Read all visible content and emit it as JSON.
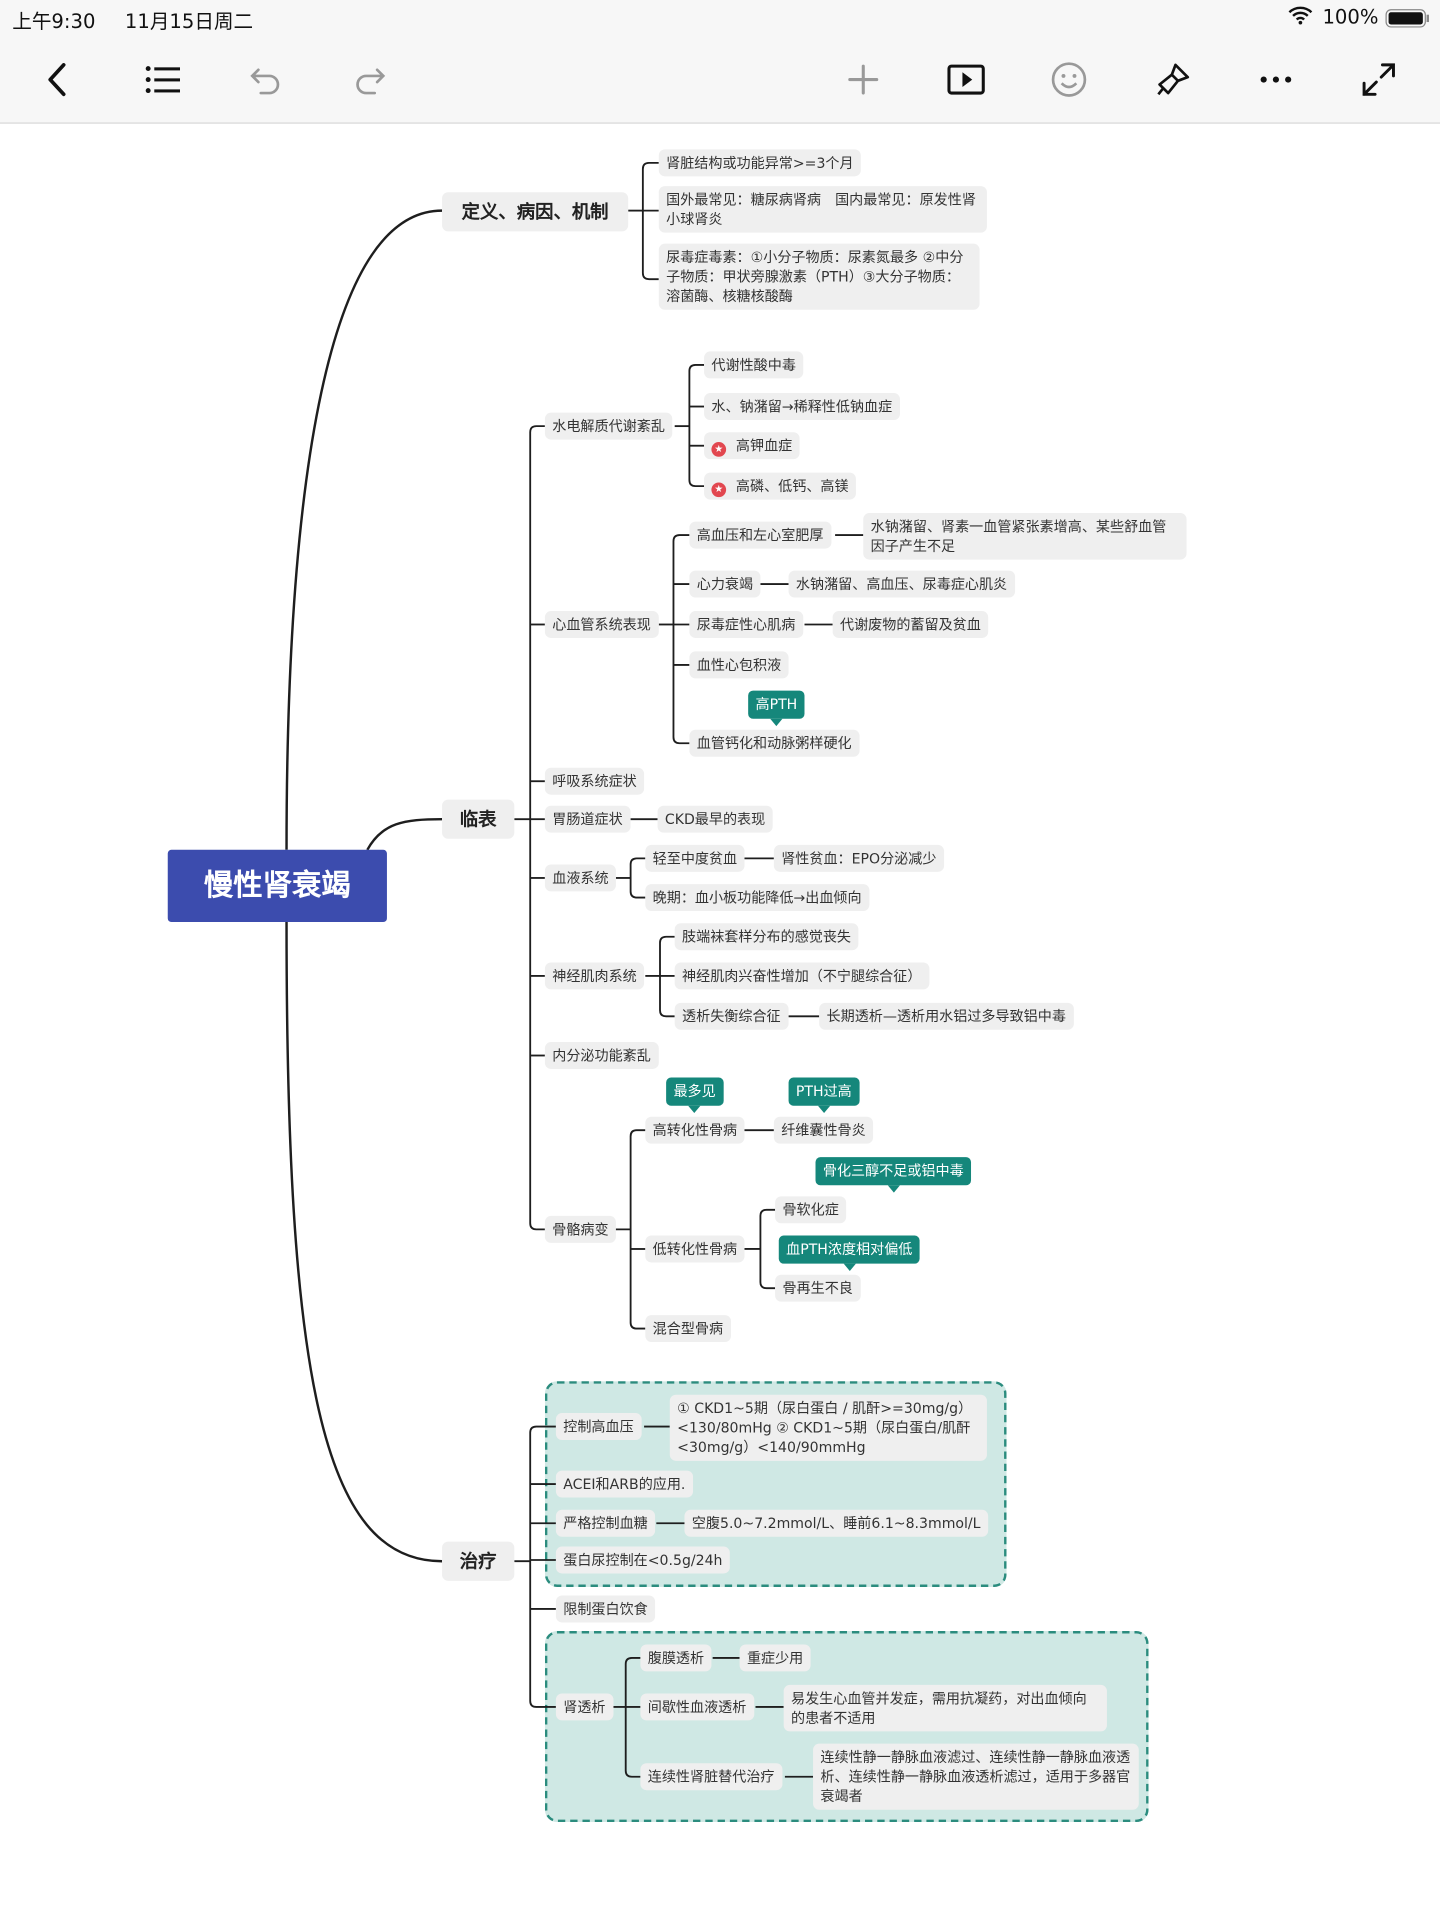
{
  "status": {
    "time": "上午9:30",
    "date": "11月15日周二",
    "battery": "100%"
  },
  "toolbar": {
    "icons": [
      "back-icon",
      "list-icon",
      "undo-icon",
      "redo-icon",
      "plus-icon",
      "play-icon",
      "emoji-icon",
      "brush-icon",
      "more-icon",
      "expand-icon"
    ]
  },
  "colors": {
    "root": "#3c4cae",
    "callout": "#15877b",
    "highlight_box": "#cfe8e4",
    "star": "#e2474f"
  },
  "root": "慢性肾衰竭",
  "def": {
    "title": "定义、病因、机制",
    "items": [
      "肾脏结构或功能异常>=3个月",
      "国外最常见：糖尿病肾病　国内最常见：原发性肾小球肾炎",
      "尿毒症毒素：①小分子物质：尿素氮最多 ②中分子物质：甲状旁腺激素（PTH）③大分子物质：溶菌酶、核糖核酸酶"
    ]
  },
  "clinical": {
    "title": "临表",
    "water": {
      "label": "水电解质代谢紊乱",
      "items": [
        "代谢性酸中毒",
        "水、钠潴留→稀释性低钠血症",
        "高钾血症",
        "高磷、低钙、高镁"
      ]
    },
    "cardio": {
      "label": "心血管系统表现",
      "items": [
        "高血压和左心室肥厚",
        "水钠潴留、肾素一血管紧张素增高、某些舒血管因子产生不足",
        "心力衰竭",
        "水钠潴留、高血压、尿毒症心肌炎",
        "尿毒症性心肌病",
        "代谢废物的蓄留及贫血",
        "血性心包积液",
        "血管钙化和动脉粥样硬化"
      ],
      "callout": "高PTH"
    },
    "resp": "呼吸系统症状",
    "gi": {
      "label": "胃肠道症状",
      "detail": "CKD最早的表现"
    },
    "blood": {
      "label": "血液系统",
      "items": [
        "轻至中度贫血",
        "肾性贫血：EPO分泌减少",
        "晚期：血小板功能降低→出血倾向"
      ]
    },
    "neuro": {
      "label": "神经肌肉系统",
      "items": [
        "肢端袜套样分布的感觉丧失",
        "神经肌肉兴奋性增加（不宁腿综合征）",
        "透析失衡综合征",
        "长期透析—透析用水铝过多导致铝中毒"
      ]
    },
    "endo": "内分泌功能紊乱",
    "bone": {
      "label": "骨骼病变",
      "high": "高转化性骨病",
      "high_callout": "最多见",
      "fibro": "纤维囊性骨炎",
      "fibro_callout": "PTH过高",
      "low": "低转化性骨病",
      "osteomalacia": "骨软化症",
      "osteomalacia_callout": "骨化三醇不足或铝中毒",
      "aplastic": "骨再生不良",
      "aplastic_callout": "血PTH浓度相对偏低",
      "mixed": "混合型骨病"
    }
  },
  "treat": {
    "title": "治疗",
    "bp": {
      "label": "控制高血压",
      "detail": "① CKD1~5期（尿白蛋白 / 肌酐>=30mg/g）　<130/80mHg ② CKD1~5期（尿白蛋白/肌酐<30mg/g）<140/90mmHg"
    },
    "acei": "ACEI和ARB的应用.",
    "glucose": {
      "label": "严格控制血糖",
      "detail": "空腹5.0~7.2mmol/L、睡前6.1~8.3mmol/L"
    },
    "protein": "蛋白尿控制在<0.5g/24h",
    "diet": "限制蛋白饮食",
    "dialysis": {
      "label": "肾透析",
      "pd": "腹膜透析",
      "pd_detail": "重症少用",
      "hd": "间歇性血液透析",
      "hd_detail": "易发生心血管并发症，需用抗凝药，对出血倾向的患者不适用",
      "crrt": "连续性肾脏替代治疗",
      "crrt_detail": "连续性静一静脉血液滤过、连续性静一静脉血液透析、连续性静一静脉血液透析滤过，适用于多器官衰竭者"
    }
  }
}
